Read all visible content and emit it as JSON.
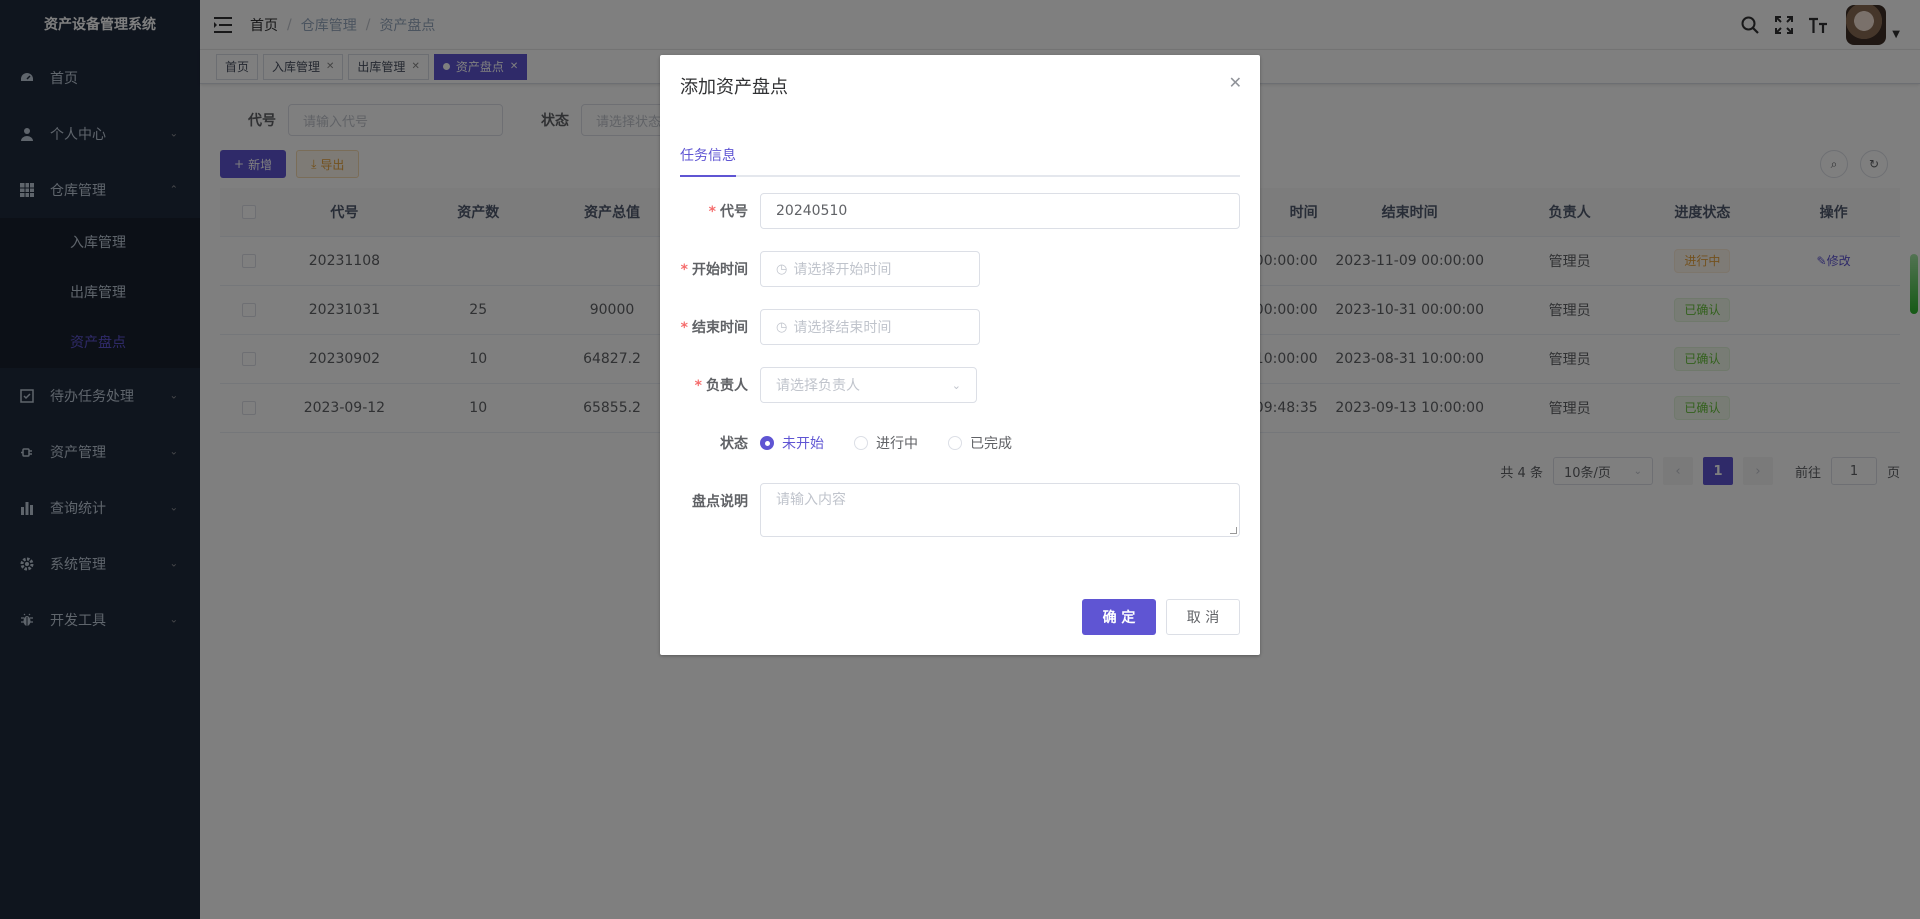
{
  "app": {
    "title": "资产设备管理系统"
  },
  "sidebar": {
    "items": [
      {
        "label": "首页",
        "icon": "dashboard-icon",
        "has_children": false
      },
      {
        "label": "个人中心",
        "icon": "user-icon",
        "has_children": true
      },
      {
        "label": "仓库管理",
        "icon": "grid-icon",
        "has_children": true,
        "expanded": true,
        "children": [
          {
            "label": "入库管理"
          },
          {
            "label": "出库管理"
          },
          {
            "label": "资产盘点",
            "active": true
          }
        ]
      },
      {
        "label": "待办任务处理",
        "icon": "checkbox-icon",
        "has_children": true
      },
      {
        "label": "资产管理",
        "icon": "plug-icon",
        "has_children": true
      },
      {
        "label": "查询统计",
        "icon": "bar-chart-icon",
        "has_children": true
      },
      {
        "label": "系统管理",
        "icon": "gear-icon",
        "has_children": true
      },
      {
        "label": "开发工具",
        "icon": "bug-icon",
        "has_children": true
      }
    ]
  },
  "breadcrumb": [
    "首页",
    "仓库管理",
    "资产盘点"
  ],
  "tags": [
    {
      "label": "首页",
      "closable": false,
      "active": false
    },
    {
      "label": "入库管理",
      "closable": true,
      "active": false
    },
    {
      "label": "出库管理",
      "closable": true,
      "active": false
    },
    {
      "label": "资产盘点",
      "closable": true,
      "active": true
    }
  ],
  "search": {
    "code_label": "代号",
    "code_placeholder": "请输入代号",
    "status_label": "状态",
    "status_placeholder": "请选择状态"
  },
  "toolbar": {
    "add_label": "新增",
    "export_label": "导出"
  },
  "table": {
    "headers": {
      "code": "代号",
      "asset_count": "资产数",
      "asset_total": "资产总值",
      "start_time": "时间",
      "end_time": "结束时间",
      "owner": "负责人",
      "progress": "进度状态",
      "ops": "操作"
    },
    "rows": [
      {
        "code": "20231108",
        "count": "",
        "total": "",
        "start": "00:00:00",
        "end": "2023-11-09 00:00:00",
        "owner": "管理员",
        "status": "进行中",
        "status_type": "warn",
        "op": "修改"
      },
      {
        "code": "20231031",
        "count": "25",
        "total": "90000",
        "start": "00:00:00",
        "end": "2023-10-31 00:00:00",
        "owner": "管理员",
        "status": "已确认",
        "status_type": "ok",
        "op": ""
      },
      {
        "code": "20230902",
        "count": "10",
        "total": "64827.2",
        "start": "10:00:00",
        "end": "2023-08-31 10:00:00",
        "owner": "管理员",
        "status": "已确认",
        "status_type": "ok",
        "op": ""
      },
      {
        "code": "2023-09-12",
        "count": "10",
        "total": "65855.2",
        "start": "09:48:35",
        "end": "2023-09-13 10:00:00",
        "owner": "管理员",
        "status": "已确认",
        "status_type": "ok",
        "op": ""
      }
    ]
  },
  "pagination": {
    "total_text": "共 4 条",
    "page_size": "10条/页",
    "current_page": "1",
    "goto_label": "前往",
    "goto_value": "1",
    "page_suffix": "页"
  },
  "dialog": {
    "title": "添加资产盘点",
    "tab": "任务信息",
    "fields": {
      "code_label": "代号",
      "code_value": "20240510",
      "start_label": "开始时间",
      "start_placeholder": "请选择开始时间",
      "end_label": "结束时间",
      "end_placeholder": "请选择结束时间",
      "owner_label": "负责人",
      "owner_placeholder": "请选择负责人",
      "status_label": "状态",
      "status_options": [
        "未开始",
        "进行中",
        "已完成"
      ],
      "status_selected": "未开始",
      "note_label": "盘点说明",
      "note_placeholder": "请输入内容"
    },
    "confirm_label": "确 定",
    "cancel_label": "取 消"
  },
  "colors": {
    "primary": "#5f55d3",
    "sidebar_bg": "#1f2a3d",
    "warning": "#e6a23c",
    "success": "#67c23a",
    "danger": "#f56c6c"
  }
}
